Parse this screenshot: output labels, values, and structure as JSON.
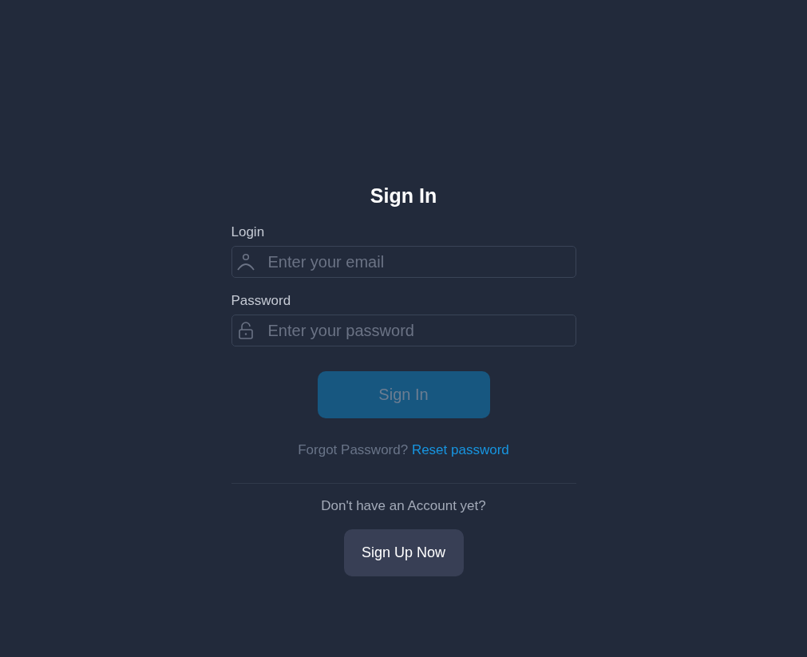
{
  "title": "Sign In",
  "fields": [
    {
      "label": "Login",
      "kind": "email",
      "placeholder": "Enter your email"
    },
    {
      "label": "Password",
      "kind": "password",
      "placeholder": "Enter your password"
    }
  ],
  "submit": {
    "label": "Sign In",
    "disabled": true
  },
  "forgot": {
    "text": "Forgot Password?",
    "link": "Reset password"
  },
  "signup": {
    "prompt": "Don't have an Account yet?",
    "button": "Sign Up Now"
  }
}
